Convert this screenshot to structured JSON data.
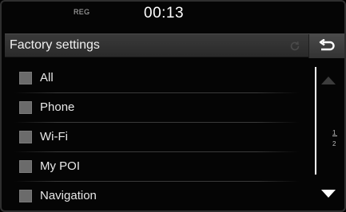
{
  "status": {
    "mode": "REG",
    "time": "00:13"
  },
  "header": {
    "title": "Factory settings"
  },
  "list": {
    "items": [
      {
        "label": "All"
      },
      {
        "label": "Phone"
      },
      {
        "label": "Wi-Fi"
      },
      {
        "label": "My POI"
      },
      {
        "label": "Navigation"
      }
    ]
  },
  "pagination": {
    "current": "1",
    "total": "2"
  },
  "icons": {
    "back": "back-arrow-icon",
    "reset": "refresh-icon",
    "up": "triangle-up-icon",
    "down": "triangle-down-icon"
  },
  "colors": {
    "background": "#000000",
    "titlebar": "#333333",
    "checkbox": "#6b6b6b",
    "text": "#e8e8e8"
  }
}
